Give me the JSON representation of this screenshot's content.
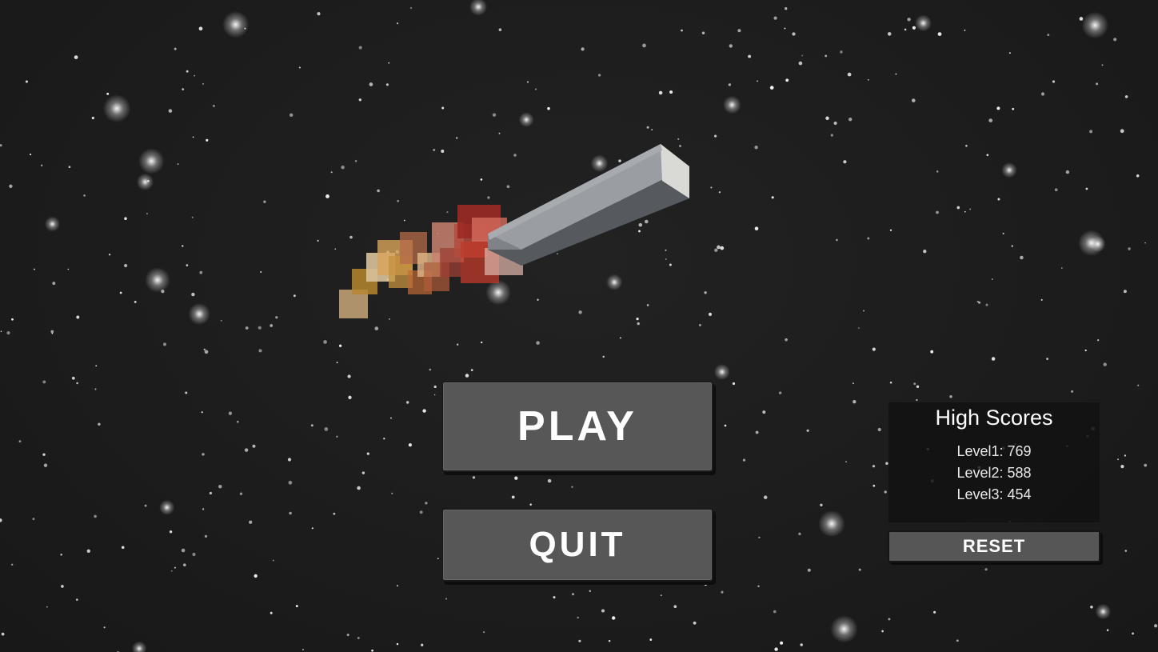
{
  "menu": {
    "play_label": "PLAY",
    "quit_label": "QUIT"
  },
  "high_scores": {
    "title": "High Scores",
    "entries": [
      "Level1: 769",
      "Level2: 588",
      "Level3: 454"
    ],
    "reset_label": "RESET"
  },
  "colors": {
    "background": "#1c1c1c",
    "button_fill": "#575757",
    "star": "#ffffff",
    "ship_body": "#8a8d92",
    "exhaust_hot": "#c0392b",
    "exhaust_warm": "#d9a45a"
  },
  "scene": {
    "objects": [
      "starfield",
      "ship-beam",
      "exhaust-trail"
    ]
  }
}
